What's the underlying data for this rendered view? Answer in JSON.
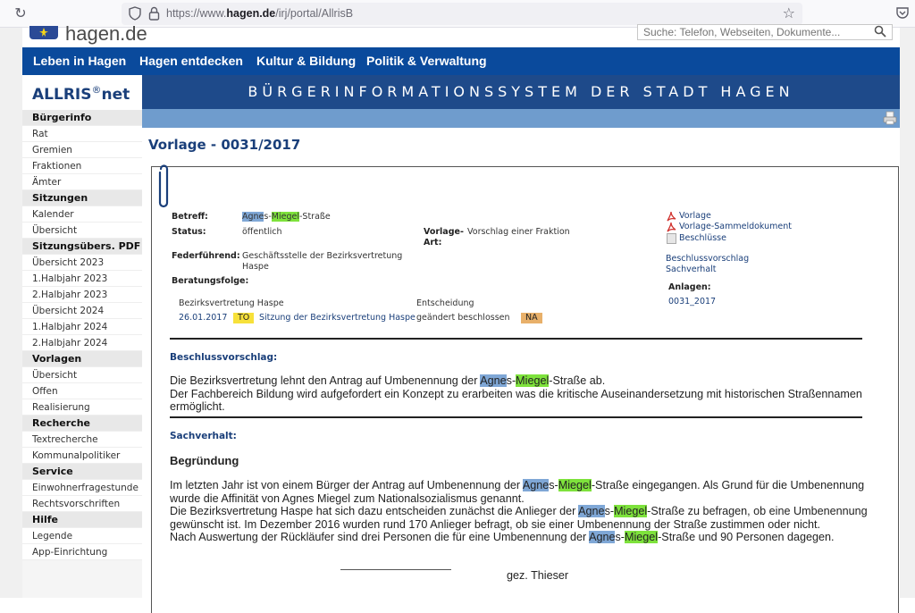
{
  "browser": {
    "url_prefix": "https://www.",
    "url_domain": "hagen.de",
    "url_path": "/irj/portal/AllrisB"
  },
  "site": {
    "logo_text": "hagen.de",
    "search_placeholder": "Suche: Telefon, Webseiten, Dokumente...",
    "nav": [
      "Leben in Hagen",
      "Hagen entdecken",
      "Kultur & Bildung",
      "Politik & Verwaltung"
    ]
  },
  "allris": {
    "logo": "ALLRIS",
    "logo_reg": "®",
    "logo_suffix": "net",
    "banner_title": "BÜRGERINFORMATIONSSYSTEM DER STADT HAGEN"
  },
  "sidebar": {
    "sections": [
      {
        "title": "Bürgerinfo",
        "items": [
          "Rat",
          "Gremien",
          "Fraktionen",
          "Ämter"
        ]
      },
      {
        "title": "Sitzungen",
        "items": [
          "Kalender",
          "Übersicht"
        ]
      },
      {
        "title": "Sitzungsübers. PDF",
        "items": [
          "Übersicht 2023",
          "1.Halbjahr 2023",
          "2.Halbjahr 2023",
          "Übersicht 2024",
          "1.Halbjahr 2024",
          "2.Halbjahr 2024"
        ]
      },
      {
        "title": "Vorlagen",
        "items": [
          "Übersicht",
          "Offen",
          "Realisierung"
        ]
      },
      {
        "title": "Recherche",
        "items": [
          "Textrecherche",
          "Kommunalpolitiker"
        ]
      },
      {
        "title": "Service",
        "items": [
          "Einwohnerfragestunde",
          "Rechtsvorschriften"
        ]
      },
      {
        "title": "Hilfe",
        "items": [
          "Legende",
          "App-Einrichtung"
        ]
      }
    ]
  },
  "document": {
    "title": "Vorlage - 0031/2017",
    "highlight_a": "Agne",
    "highlight_b": "Miegel",
    "betreff_label": "Betreff:",
    "betreff_suffix": "-Straße",
    "status_label": "Status:",
    "status_value": "öffentlich",
    "vorlage_art_label_1": "Vorlage-",
    "vorlage_art_label_2": "Art:",
    "vorlage_art_value": "Vorschlag einer Fraktion",
    "federfuehrend_label": "Federführend:",
    "federfuehrend_value_1": "Geschäftsstelle der Bezirksvertretung",
    "federfuehrend_value_2": "Haspe",
    "beratungsfolge_label": "Beratungsfolge:",
    "beratung": {
      "gremium": "Bezirksvertretung Haspe",
      "col_entscheidung": "Entscheidung",
      "date": "26.01.2017",
      "to_badge": "TO",
      "sitzung": "Sitzung der Bezirksvertretung Haspe",
      "result": "geändert beschlossen",
      "na_badge": "NA"
    },
    "downloads": [
      "Vorlage",
      "Vorlage-Sammeldokument",
      "Beschlüsse"
    ],
    "anchors": [
      "Beschlussvorschlag",
      "Sachverhalt"
    ],
    "anlagen_label": "Anlagen:",
    "anlagen": [
      "0031_2017"
    ],
    "beschlussvorschlag_heading": "Beschlussvorschlag:",
    "beschluss_line1_pre": "Die Bezirksvertretung lehnt den Antrag auf Umbenennung der ",
    "beschluss_line1_post": "-Straße ab.",
    "beschluss_line2": "Der Fachbereich Bildung wird aufgefordert ein Konzept zu erarbeiten was die kritische Auseinandersetzung mit historischen Straßennamen",
    "beschluss_line3": "ermöglicht.",
    "sachverhalt_heading": "Sachverhalt:",
    "begruendung_heading": "Begründung",
    "s_line1_pre": "Im letzten Jahr ist von einem Bürger der Antrag auf Umbenennung der ",
    "s_line1_post": "-Straße eingegangen. Als Grund für die Umbenennung",
    "s_line2": "wurde die Affinität von Agnes Miegel zum Nationalsozialismus genannt.",
    "s_line3_pre": "Die Bezirksvertretung Haspe hat sich dazu entscheiden zunächst die Anlieger der ",
    "s_line3_post": "-Straße zu befragen, ob eine Umbenennung",
    "s_line4": "gewünscht ist. Im Dezember 2016 wurden rund 170 Anlieger befragt, ob sie einer Umbenennung der Straße zustimmen oder nicht.",
    "s_line5_pre": "Nach Auswertung der Rückläufer sind drei Personen die für eine Umbenennung der ",
    "s_line5_post": "-Straße und 90 Personen dagegen.",
    "signature": "gez. Thieser",
    "hl_s": "s-"
  },
  "colors": {
    "nav_blue": "#0a4a9c",
    "banner_blue": "#1e4a8a",
    "subbar_blue": "#6f9ccd",
    "highlight_blue": "#7fa7d6",
    "highlight_green": "#7ee23c",
    "to_badge": "#f7e13a",
    "na_badge": "#e8b06a"
  }
}
